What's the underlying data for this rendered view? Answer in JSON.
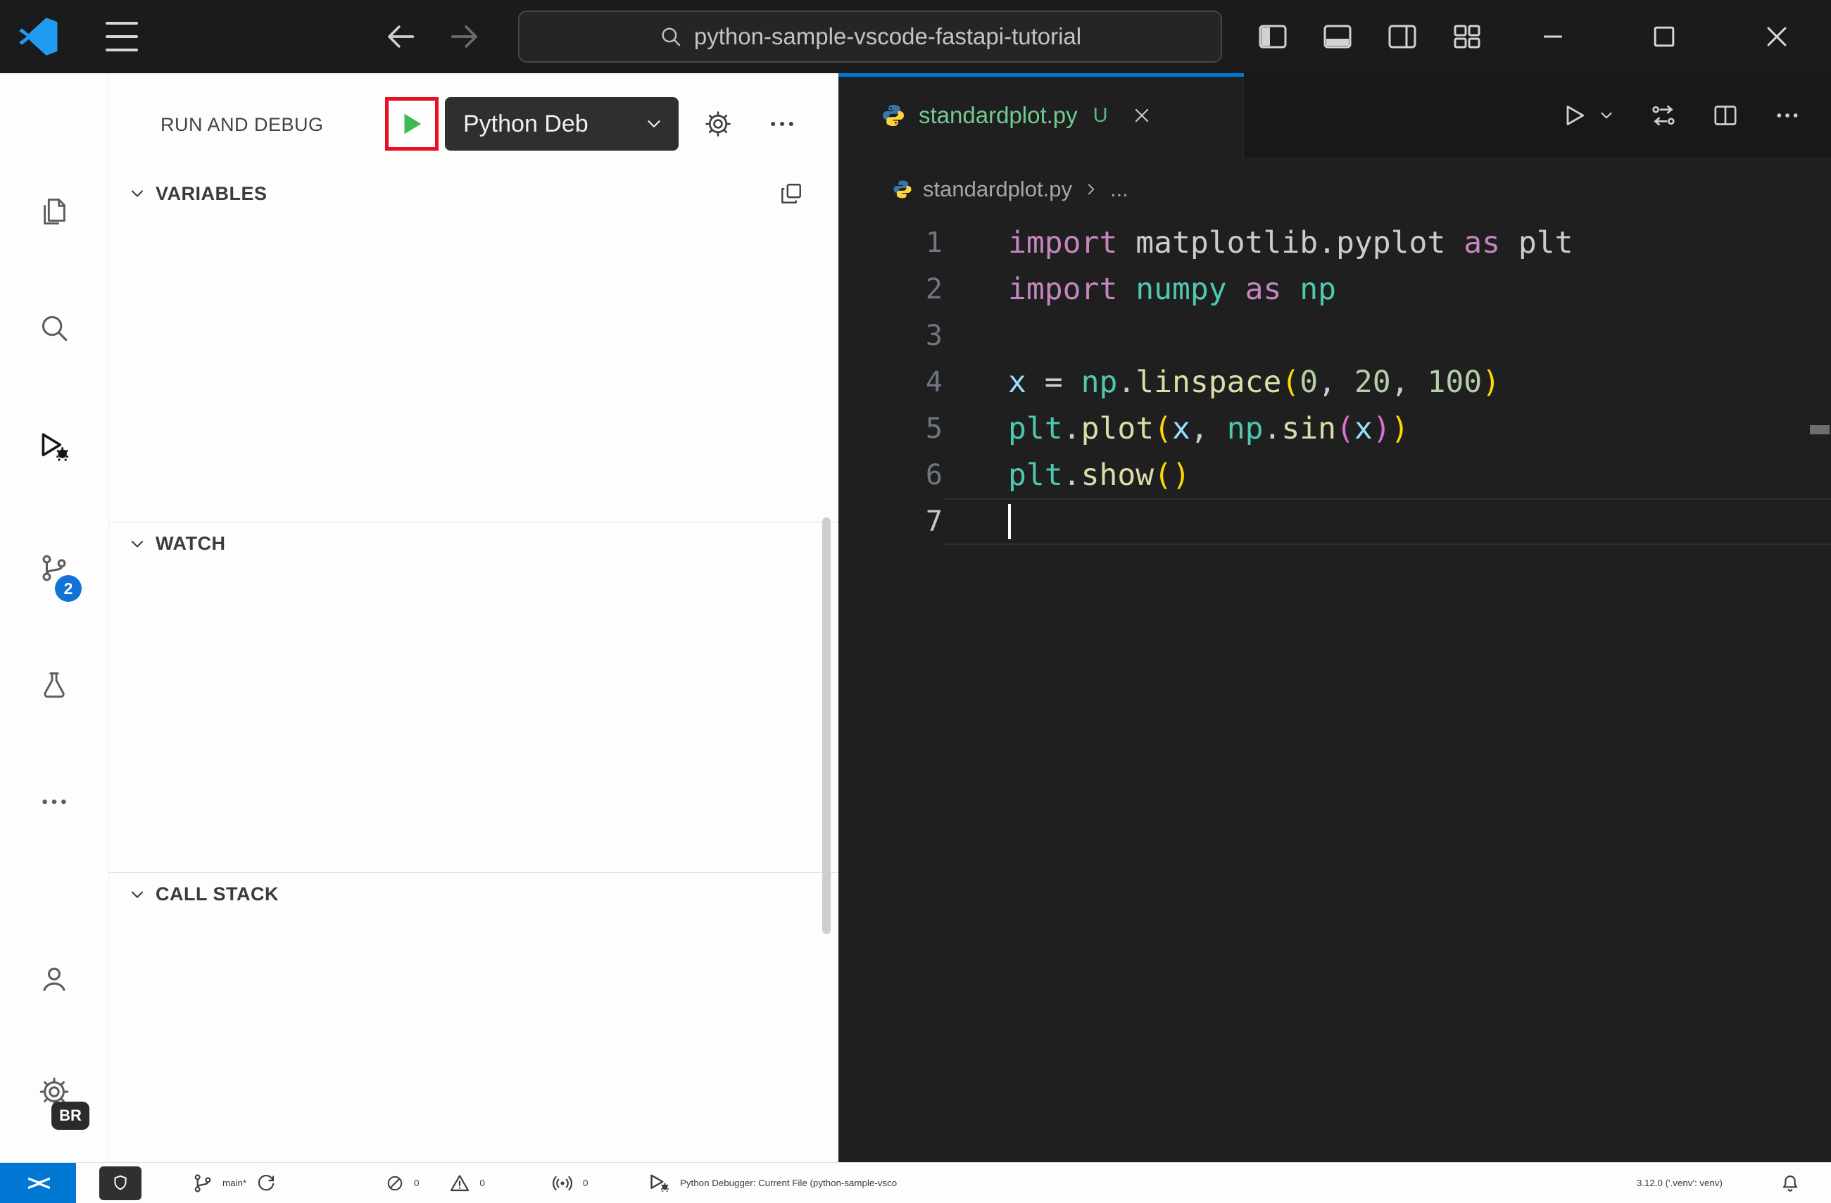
{
  "window": {
    "search_value": "python-sample-vscode-fastapi-tutorial"
  },
  "activity_bar": {
    "source_control_badge": "2",
    "profile_badge": "BR"
  },
  "sidebar": {
    "title": "RUN AND DEBUG",
    "config_selector": "Python Deb",
    "variables_label": "VARIABLES",
    "watch_label": "WATCH",
    "call_stack_label": "CALL STACK"
  },
  "editor": {
    "tab_label": "standardplot.py",
    "tab_modified_badge": "U",
    "breadcrumb_file": "standardplot.py",
    "breadcrumb_more": "...",
    "code": {
      "lines": [
        {
          "num": "1",
          "tokens": [
            {
              "t": "import",
              "c": "k"
            },
            {
              "t": " matplotlib.pyplot ",
              "c": "p"
            },
            {
              "t": "as",
              "c": "k"
            },
            {
              "t": " plt",
              "c": "p"
            }
          ]
        },
        {
          "num": "2",
          "tokens": [
            {
              "t": "import",
              "c": "k"
            },
            {
              "t": " ",
              "c": "p"
            },
            {
              "t": "numpy",
              "c": "m"
            },
            {
              "t": " ",
              "c": "p"
            },
            {
              "t": "as",
              "c": "k"
            },
            {
              "t": " ",
              "c": "p"
            },
            {
              "t": "np",
              "c": "m"
            }
          ]
        },
        {
          "num": "3",
          "tokens": []
        },
        {
          "num": "4",
          "tokens": [
            {
              "t": "x",
              "c": "v"
            },
            {
              "t": " = ",
              "c": "p"
            },
            {
              "t": "np",
              "c": "m"
            },
            {
              "t": ".",
              "c": "p"
            },
            {
              "t": "linspace",
              "c": "f"
            },
            {
              "t": "(",
              "c": "b1"
            },
            {
              "t": "0",
              "c": "n"
            },
            {
              "t": ", ",
              "c": "p"
            },
            {
              "t": "20",
              "c": "n"
            },
            {
              "t": ", ",
              "c": "p"
            },
            {
              "t": "100",
              "c": "n"
            },
            {
              "t": ")",
              "c": "b1"
            }
          ]
        },
        {
          "num": "5",
          "tokens": [
            {
              "t": "plt",
              "c": "m"
            },
            {
              "t": ".",
              "c": "p"
            },
            {
              "t": "plot",
              "c": "f"
            },
            {
              "t": "(",
              "c": "b1"
            },
            {
              "t": "x",
              "c": "v"
            },
            {
              "t": ", ",
              "c": "p"
            },
            {
              "t": "np",
              "c": "m"
            },
            {
              "t": ".",
              "c": "p"
            },
            {
              "t": "sin",
              "c": "f"
            },
            {
              "t": "(",
              "c": "b2"
            },
            {
              "t": "x",
              "c": "v"
            },
            {
              "t": ")",
              "c": "b2"
            },
            {
              "t": ")",
              "c": "b1"
            }
          ]
        },
        {
          "num": "6",
          "tokens": [
            {
              "t": "plt",
              "c": "m"
            },
            {
              "t": ".",
              "c": "p"
            },
            {
              "t": "show",
              "c": "f"
            },
            {
              "t": "()",
              "c": "b1"
            }
          ]
        },
        {
          "num": "7",
          "tokens": [],
          "current": true,
          "cursor": true
        }
      ]
    }
  },
  "status_bar": {
    "remote_glyph": "><",
    "branch_label": "main*",
    "error_count": "0",
    "warning_count": "0",
    "ports_count": "0",
    "debugger_label": "Python Debugger: Current File (python-sample-vsco",
    "python_version": "3.12.0 ('.venv': venv)"
  },
  "colors": {
    "tab_accent": "#0078D4",
    "untracked_green": "#73C991",
    "run_green": "#3FB950",
    "annotation_red": "#E81123",
    "remote_blue": "#0078D4",
    "badge_blue": "#1372D6",
    "syntax": {
      "keyword": "#C586C0",
      "plain": "#CCCCCC",
      "module": "#4EC9B0",
      "variable": "#9CDCFE",
      "function": "#DCDCAA",
      "number": "#B5CEA8",
      "bracket1": "#FFD700",
      "bracket2": "#DA70D6"
    }
  }
}
